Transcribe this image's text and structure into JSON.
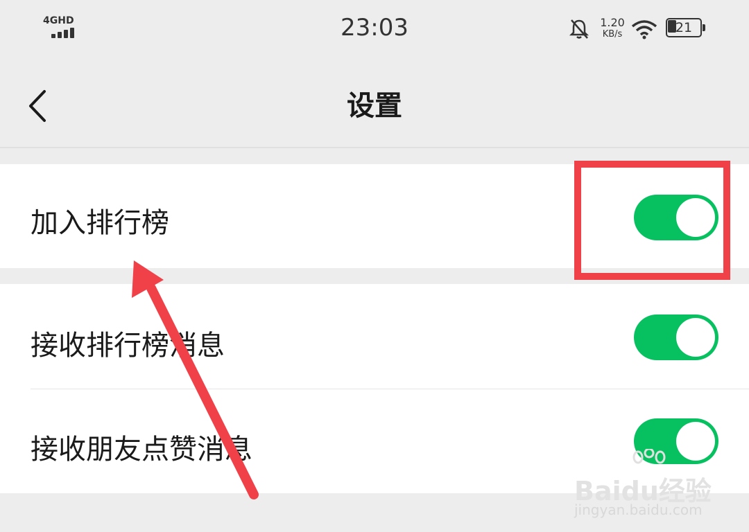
{
  "status_bar": {
    "network": "4GHD",
    "time": "23:03",
    "speed_value": "1.20",
    "speed_unit": "KB/s",
    "battery": "21",
    "icons": [
      "signal-icon",
      "mute-icon",
      "wifi-icon",
      "battery-icon"
    ]
  },
  "nav": {
    "title": "设置",
    "back_icon": "chevron-left-icon"
  },
  "settings": [
    {
      "label": "加入排行榜",
      "enabled": true
    },
    {
      "label": "接收排行榜消息",
      "enabled": true
    },
    {
      "label": "接收朋友点赞消息",
      "enabled": true
    }
  ],
  "watermark": {
    "logo": "Baidu经验",
    "url": "jingyan.baidu.com"
  },
  "colors": {
    "toggle_on": "#07c160",
    "annotation": "#f04048",
    "background": "#ededed"
  }
}
